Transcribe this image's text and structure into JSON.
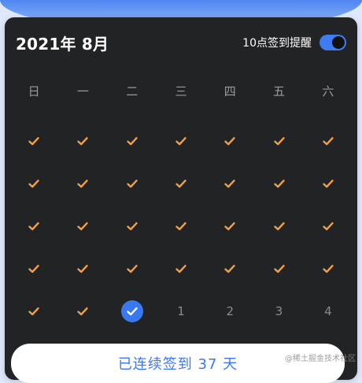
{
  "header": {
    "month_title": "2021年 8月",
    "reminder_label": "10点签到提醒",
    "reminder_enabled": true
  },
  "weekdays": [
    "日",
    "一",
    "二",
    "三",
    "四",
    "五",
    "六"
  ],
  "days": [
    {
      "status": "checked"
    },
    {
      "status": "checked"
    },
    {
      "status": "checked"
    },
    {
      "status": "checked"
    },
    {
      "status": "checked"
    },
    {
      "status": "checked"
    },
    {
      "status": "checked"
    },
    {
      "status": "checked"
    },
    {
      "status": "checked"
    },
    {
      "status": "checked"
    },
    {
      "status": "checked"
    },
    {
      "status": "checked"
    },
    {
      "status": "checked"
    },
    {
      "status": "checked"
    },
    {
      "status": "checked"
    },
    {
      "status": "checked"
    },
    {
      "status": "checked"
    },
    {
      "status": "checked"
    },
    {
      "status": "checked"
    },
    {
      "status": "checked"
    },
    {
      "status": "checked"
    },
    {
      "status": "checked"
    },
    {
      "status": "checked"
    },
    {
      "status": "checked"
    },
    {
      "status": "checked"
    },
    {
      "status": "checked"
    },
    {
      "status": "checked"
    },
    {
      "status": "checked"
    },
    {
      "status": "checked"
    },
    {
      "status": "checked"
    },
    {
      "status": "today"
    },
    {
      "status": "future",
      "label": "1"
    },
    {
      "status": "future",
      "label": "2"
    },
    {
      "status": "future",
      "label": "3"
    },
    {
      "status": "future",
      "label": "4"
    }
  ],
  "streak_button": {
    "label": "已连续签到 37 天"
  },
  "watermark": "@稀土掘金技术社区",
  "colors": {
    "check_mark": "#f0a04b",
    "accent": "#3a78f2",
    "card_bg": "#222324"
  },
  "icons": {
    "checked_day": "check-icon",
    "today": "check-circle-icon"
  }
}
